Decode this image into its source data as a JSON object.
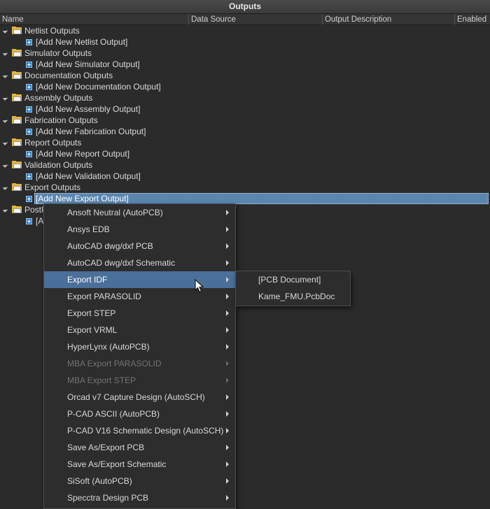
{
  "panel": {
    "title": "Outputs"
  },
  "columns": [
    "Name",
    "Data Source",
    "Output Description",
    "Enabled"
  ],
  "groups": [
    {
      "label": "Netlist Outputs",
      "add": "[Add New Netlist Output]"
    },
    {
      "label": "Simulator Outputs",
      "add": "[Add New Simulator Output]"
    },
    {
      "label": "Documentation Outputs",
      "add": "[Add New Documentation Output]"
    },
    {
      "label": "Assembly Outputs",
      "add": "[Add New Assembly Output]"
    },
    {
      "label": "Fabrication Outputs",
      "add": "[Add New Fabrication Output]"
    },
    {
      "label": "Report Outputs",
      "add": "[Add New Report Output]"
    },
    {
      "label": "Validation Outputs",
      "add": "[Add New Validation Output]"
    },
    {
      "label": "Export Outputs",
      "add": "[Add New Export Output]"
    },
    {
      "label": "PostP",
      "add": "[A"
    }
  ],
  "context_menu": {
    "items": [
      "Ansoft Neutral (AutoPCB)",
      "Ansys EDB",
      "AutoCAD dwg/dxf PCB",
      "AutoCAD dwg/dxf Schematic",
      "Export IDF",
      "Export PARASOLID",
      "Export STEP",
      "Export VRML",
      "HyperLynx (AutoPCB)",
      "MBA Export PARASOLID",
      "MBA Export STEP",
      "Orcad v7 Capture Design (AutoSCH)",
      "P-CAD ASCII (AutoPCB)",
      "P-CAD V16 Schematic Design (AutoSCH)",
      "Save As/Export PCB",
      "Save As/Export Schematic",
      "SiSoft (AutoPCB)",
      "Specctra Design PCB"
    ],
    "highlighted": "Export IDF",
    "disabled": [
      "MBA Export PARASOLID",
      "MBA Export STEP"
    ]
  },
  "submenu": {
    "items": [
      "[PCB Document]",
      "Kame_FMU.PcbDoc"
    ]
  }
}
